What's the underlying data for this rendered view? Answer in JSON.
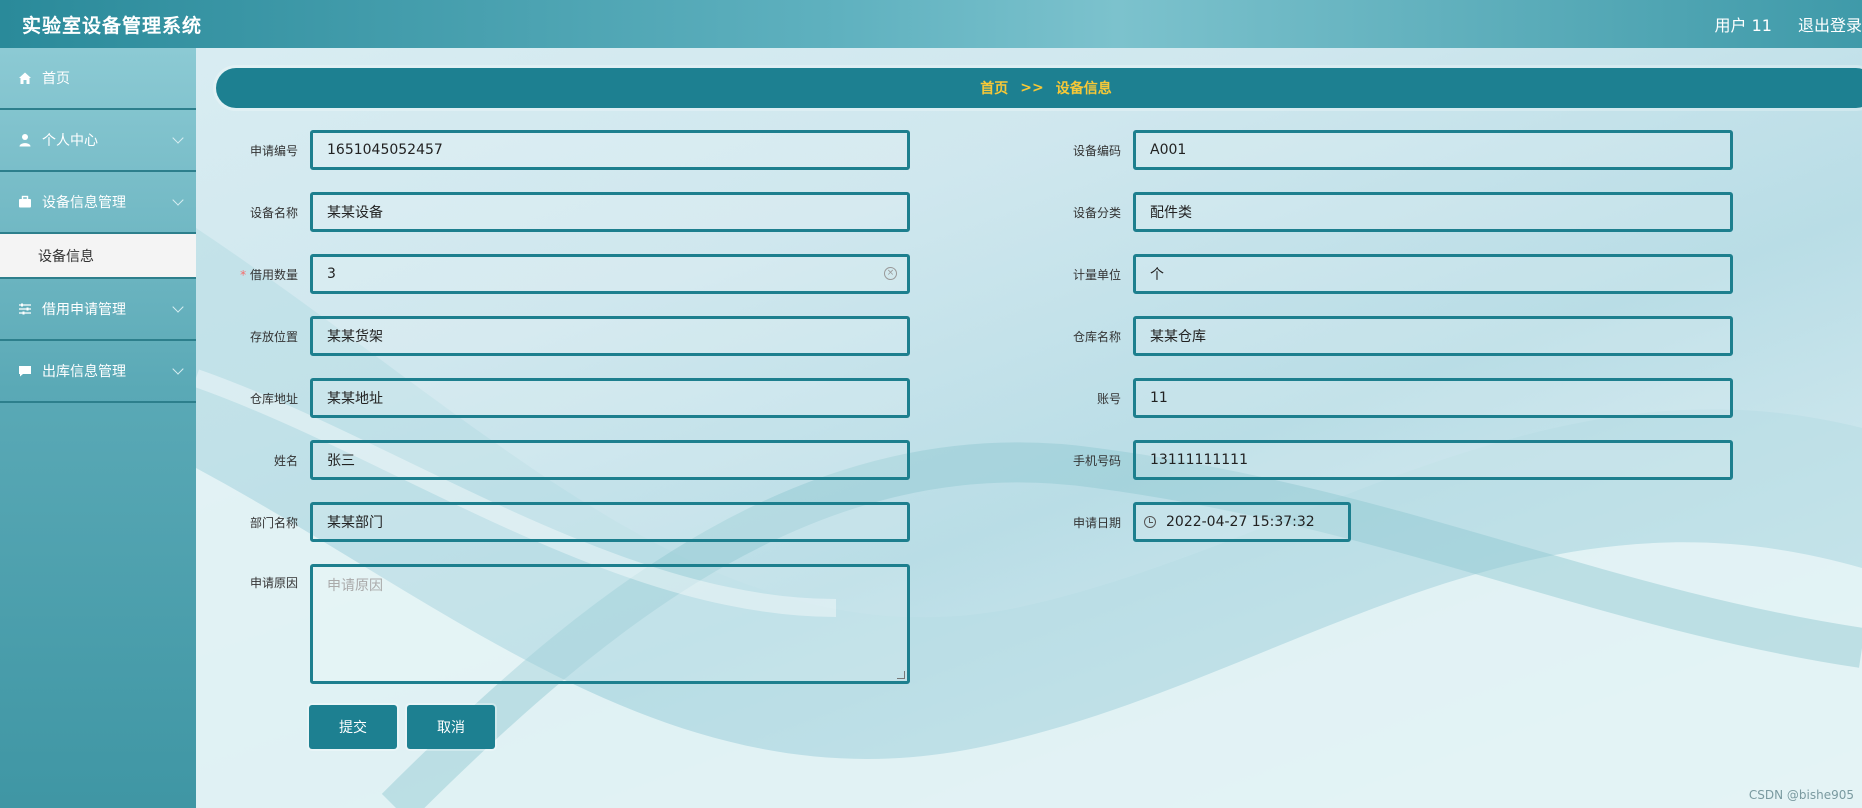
{
  "header": {
    "title": "实验室设备管理系统",
    "user": "用户 11",
    "logout": "退出登录"
  },
  "sidebar": {
    "items": [
      {
        "label": "首页",
        "icon": "home-icon"
      },
      {
        "label": "个人中心",
        "icon": "user-icon"
      },
      {
        "label": "设备信息管理",
        "icon": "briefcase-icon"
      },
      {
        "label": "借用申请管理",
        "icon": "sliders-icon"
      },
      {
        "label": "出库信息管理",
        "icon": "chat-icon"
      }
    ],
    "subitem": "设备信息"
  },
  "breadcrumb": {
    "home": "首页",
    "sep": ">>",
    "current": "设备信息"
  },
  "form": {
    "apply_no": {
      "label": "申请编号",
      "value": "1651045052457"
    },
    "device_code": {
      "label": "设备编码",
      "value": "A001"
    },
    "device_name": {
      "label": "设备名称",
      "value": "某某设备"
    },
    "device_category": {
      "label": "设备分类",
      "value": "配件类"
    },
    "borrow_qty": {
      "label": "借用数量",
      "value": "3"
    },
    "unit": {
      "label": "计量单位",
      "value": "个"
    },
    "location": {
      "label": "存放位置",
      "value": "某某货架"
    },
    "warehouse_name": {
      "label": "仓库名称",
      "value": "某某仓库"
    },
    "warehouse_addr": {
      "label": "仓库地址",
      "value": "某某地址"
    },
    "account": {
      "label": "账号",
      "value": "11"
    },
    "name": {
      "label": "姓名",
      "value": "张三"
    },
    "phone": {
      "label": "手机号码",
      "value": "13111111111"
    },
    "department": {
      "label": "部门名称",
      "value": "某某部门"
    },
    "apply_date": {
      "label": "申请日期",
      "value": "2022-04-27 15:37:32"
    },
    "reason": {
      "label": "申请原因",
      "placeholder": "申请原因"
    }
  },
  "buttons": {
    "submit": "提交",
    "cancel": "取消"
  },
  "watermark": "CSDN @bishe905",
  "colors": {
    "primary": "#1d8091",
    "breadcrumb_text": "#f7c837"
  }
}
